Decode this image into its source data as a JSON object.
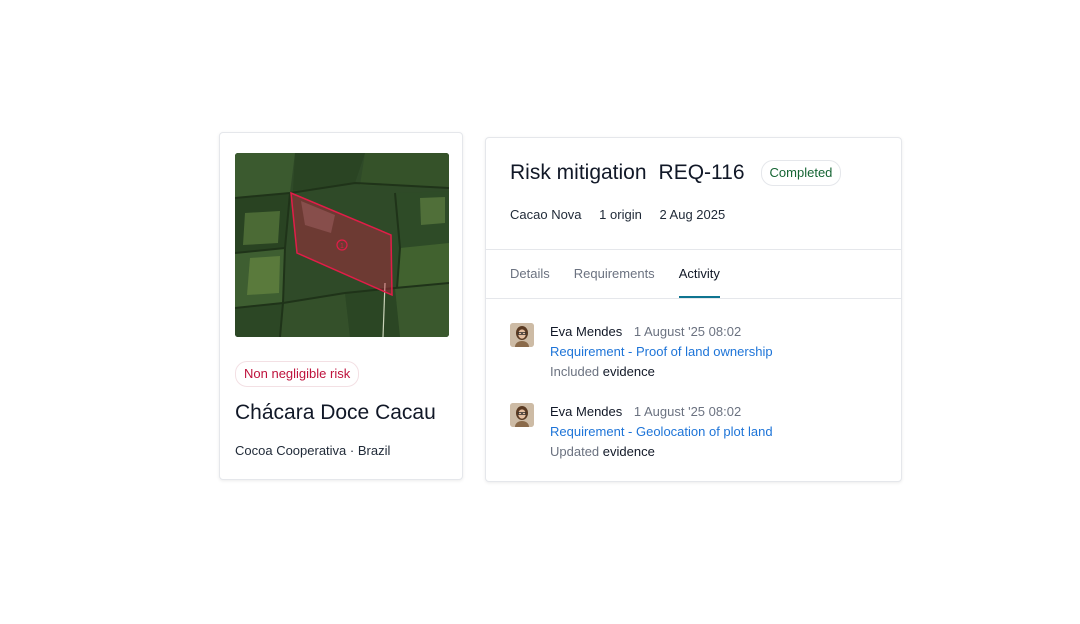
{
  "plot_card": {
    "risk_label": "Non negligible risk",
    "name": "Chácara Doce Cacau",
    "meta": "Cocoa Cooperativa · Brazil",
    "map_marker": "1"
  },
  "request": {
    "title": "Risk mitigation",
    "id": "REQ-116",
    "status": "Completed",
    "meta": {
      "company": "Cacao Nova",
      "origins": "1 origin",
      "date": "2 Aug 2025"
    }
  },
  "tabs": [
    {
      "label": "Details",
      "active": false
    },
    {
      "label": "Requirements",
      "active": false
    },
    {
      "label": "Activity",
      "active": true
    }
  ],
  "activity": [
    {
      "user": "Eva Mendes",
      "time": "1 August '25 08:02",
      "link": "Requirement - Proof of land ownership",
      "verb": "Included",
      "object": "evidence"
    },
    {
      "user": "Eva Mendes",
      "time": "1 August '25 08:02",
      "link": "Requirement - Geolocation of plot land",
      "verb": "Updated",
      "object": "evidence"
    }
  ],
  "colors": {
    "risk": "#be123c",
    "status": "#166534",
    "link": "#1d74d8",
    "tab_indicator": "#0e7490",
    "polygon": "#e11d48"
  },
  "icons": [
    "satellite-map-image",
    "user-avatar-icon"
  ]
}
